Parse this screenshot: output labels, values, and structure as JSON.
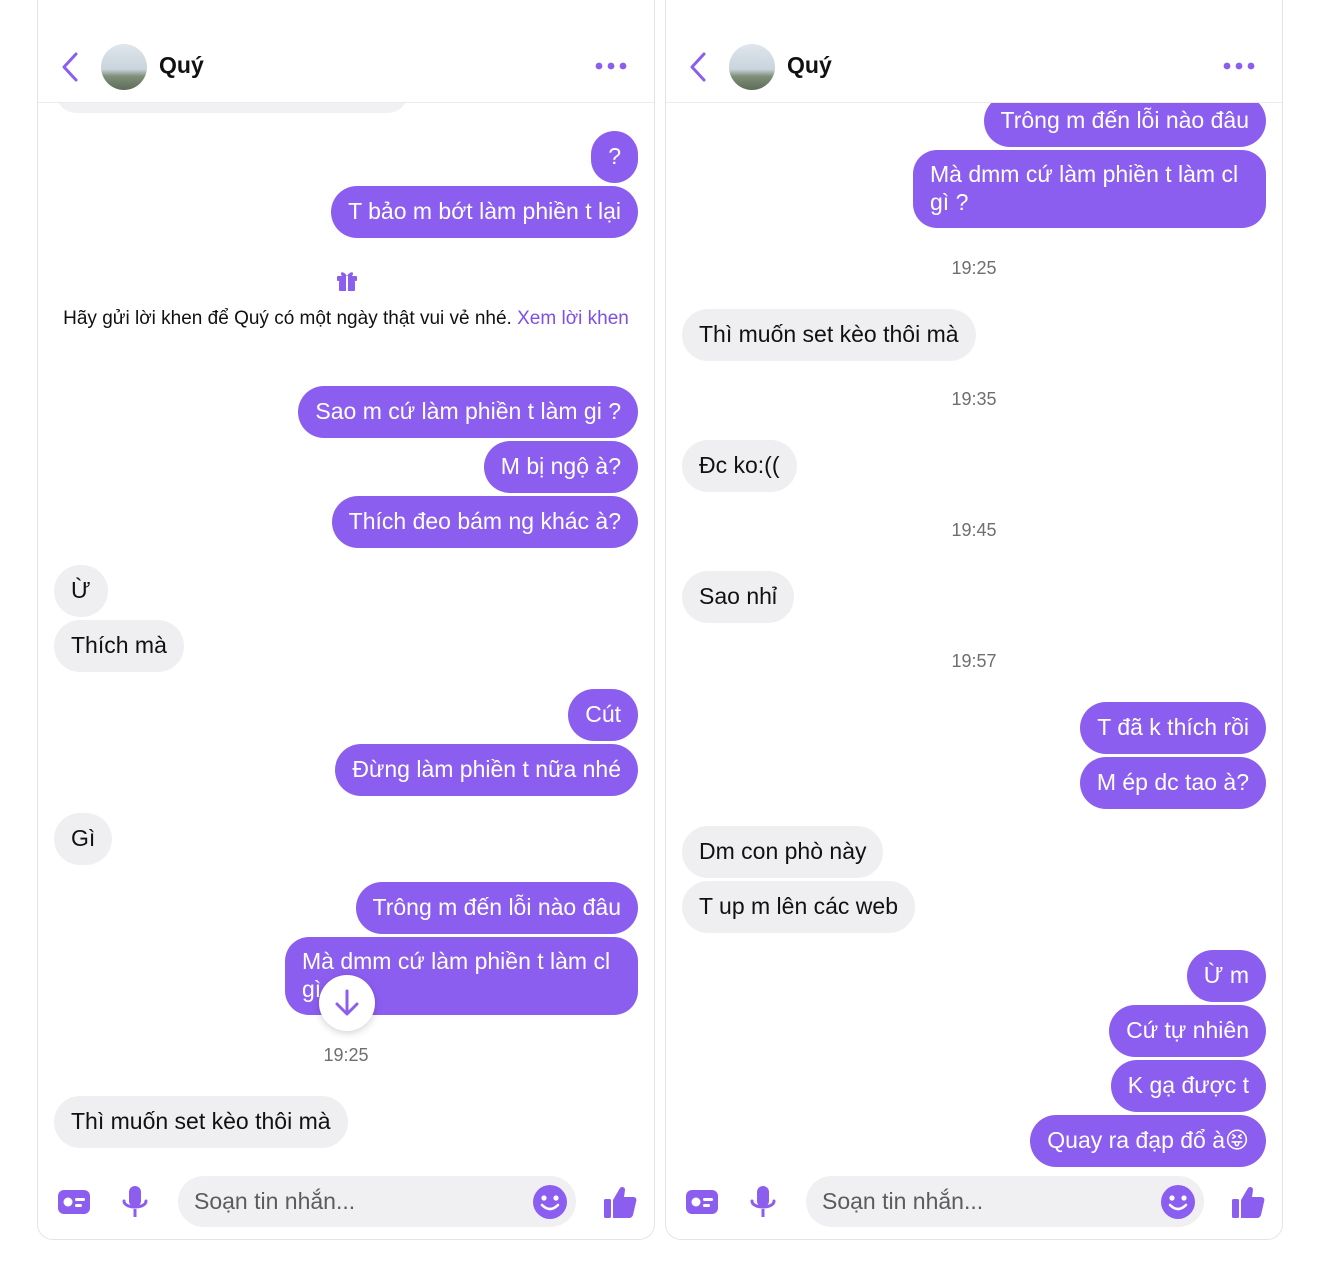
{
  "left": {
    "header": {
      "name": "Quý"
    },
    "notice": {
      "text": "Hãy gửi lời khen để Quý có một ngày thật vui vẻ nhé.",
      "link": "Xem lời khen"
    },
    "messages": [
      {
        "dir": "out",
        "text": "?"
      },
      {
        "dir": "out",
        "text": "T bảo m bớt làm phiền t lại"
      },
      {
        "dir": "out",
        "text": "Sao m cứ làm phiền t làm gi ?"
      },
      {
        "dir": "out",
        "text": "M bị ngộ à?"
      },
      {
        "dir": "out",
        "text": "Thích đeo bám ng khác à?"
      },
      {
        "dir": "in",
        "text": "Ừ"
      },
      {
        "dir": "in",
        "text": "Thích mà"
      },
      {
        "dir": "out",
        "text": "Cút"
      },
      {
        "dir": "out",
        "text": "Đừng làm phiền t nữa nhé"
      },
      {
        "dir": "in",
        "text": "Gì"
      },
      {
        "dir": "out",
        "text": "Trông m đến lỗi nào đâu"
      },
      {
        "dir": "out",
        "text": "Mà dmm cứ làm phiền t làm cl gì ?"
      },
      {
        "dir": "in",
        "text": "Thì muốn set kèo thôi mà"
      }
    ],
    "timestamps": [
      "19:25"
    ],
    "composer": {
      "placeholder": "Soạn tin nhắn..."
    }
  },
  "right": {
    "header": {
      "name": "Quý"
    },
    "messages": [
      {
        "dir": "out",
        "text": "Trông m đến lỗi nào đâu"
      },
      {
        "dir": "out",
        "text": "Mà dmm cứ làm phiền t làm cl gì ?"
      },
      {
        "dir": "in",
        "text": "Thì muốn set kèo thôi mà"
      },
      {
        "dir": "in",
        "text": "Đc ko:(("
      },
      {
        "dir": "in",
        "text": "Sao nhỉ"
      },
      {
        "dir": "out",
        "text": "T đã k thích rồi"
      },
      {
        "dir": "out",
        "text": "M ép dc tao à?"
      },
      {
        "dir": "in",
        "text": "Dm con phò này"
      },
      {
        "dir": "in",
        "text": "T up m lên các web"
      },
      {
        "dir": "out",
        "text": "Ừ m"
      },
      {
        "dir": "out",
        "text": "Cứ tự nhiên"
      },
      {
        "dir": "out",
        "text": "K gạ được t"
      },
      {
        "dir": "out",
        "text": "Quay ra đạp đổ à",
        "emoji": "😝"
      }
    ],
    "timestamps": [
      "19:25",
      "19:35",
      "19:45",
      "19:57"
    ],
    "composer": {
      "placeholder": "Soạn tin nhắn..."
    }
  },
  "colors": {
    "accent": "#8c5ef0",
    "incoming_bubble": "#efeff1",
    "link": "#7d4fe8"
  },
  "icons": [
    "back-chevron-icon",
    "more-dots-icon",
    "gift-icon",
    "scroll-down-arrow-icon",
    "card-icon",
    "mic-icon",
    "emoji-icon",
    "thumbs-up-icon"
  ]
}
